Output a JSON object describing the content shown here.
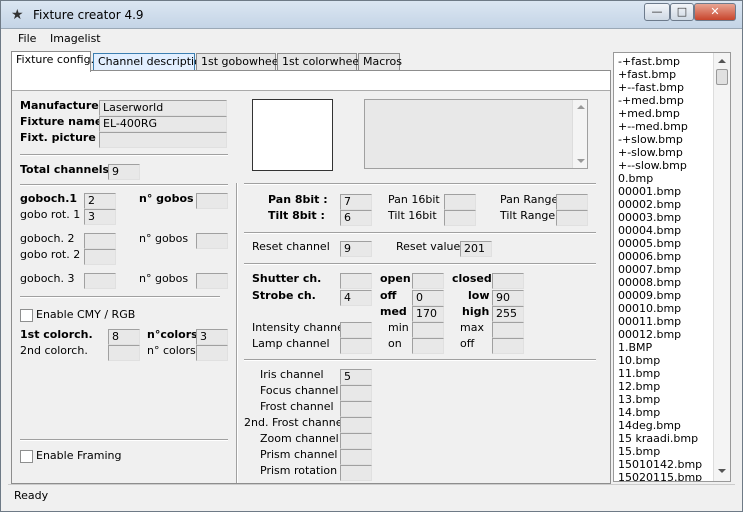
{
  "window": {
    "title": "Fixture creator 4.9"
  },
  "menu": [
    "File",
    "Imagelist"
  ],
  "tabs": [
    "Fixture config.",
    "Channel description",
    "1st gobowheel",
    "1st colorwheel",
    "Macros"
  ],
  "labels": {
    "manufacturer": "Manufacturer",
    "fixture_name": "Fixture name",
    "fixt_picture": "Fixt. picture",
    "total_channels": "Total channels",
    "goboch1": "goboch.1",
    "n_gobos_1": "n° gobos",
    "gobo_rot1": "gobo rot. 1",
    "goboch2": "goboch. 2",
    "n_gobos_2": "n° gobos",
    "gobo_rot2": "gobo rot. 2",
    "goboch3": "goboch. 3",
    "n_gobos_3": "n° gobos",
    "enable_cmy": "Enable CMY / RGB",
    "colorch1": "1st colorch.",
    "n_colors_1": "n°colors",
    "colorch2": "2nd colorch.",
    "n_colors_2": "n° colors",
    "enable_framing": "Enable Framing",
    "pan8": "Pan 8bit :",
    "tilt8": "Tilt 8bit :",
    "pan16": "Pan 16bit",
    "tilt16": "Tilt 16bit",
    "pan_range": "Pan Range",
    "tilt_range": "Tilt Range",
    "reset_channel": "Reset channel",
    "reset_value": "Reset value",
    "shutter": "Shutter ch.",
    "strobe": "Strobe ch.",
    "open": "open",
    "closed": "closed",
    "off": "off",
    "low": "low",
    "med": "med",
    "high": "high",
    "intensity": "Intensity channel",
    "min": "min",
    "max": "max",
    "lamp": "Lamp channel",
    "on": "on",
    "lamp_off": "off",
    "iris": "Iris channel",
    "focus": "Focus channel",
    "frost": "Frost channel",
    "frost2": "2nd. Frost channel",
    "zoom": "Zoom channel",
    "prism": "Prism channel",
    "prism_rot": "Prism rotation"
  },
  "values": {
    "manufacturer": "Laserworld",
    "fixture_name": "EL-400RG",
    "fixt_picture": "",
    "total_channels": "9",
    "goboch1": "2",
    "n_gobos_1": "",
    "gobo_rot1": "3",
    "goboch2": "",
    "n_gobos_2": "",
    "gobo_rot2": "",
    "goboch3": "",
    "n_gobos_3": "",
    "colorch1": "8",
    "n_colors_1": "3",
    "colorch2": "",
    "n_colors_2": "",
    "pan8": "7",
    "tilt8": "6",
    "pan16": "",
    "tilt16": "",
    "pan_range": "",
    "tilt_range": "",
    "reset_channel": "9",
    "reset_value": "201",
    "shutter": "",
    "open": "",
    "closed": "",
    "strobe": "4",
    "off": "0",
    "low": "90",
    "med": "170",
    "high": "255",
    "intensity": "",
    "min": "",
    "max": "",
    "lamp": "",
    "on": "",
    "lamp_off": "",
    "iris": "5",
    "focus": "",
    "frost": "",
    "frost2": "",
    "zoom": "",
    "prism": "",
    "prism_rot": ""
  },
  "imagelist": [
    "-+fast.bmp",
    "+fast.bmp",
    "+--fast.bmp",
    "-+med.bmp",
    "+med.bmp",
    "+--med.bmp",
    "-+slow.bmp",
    "+-slow.bmp",
    "+--slow.bmp",
    "0.bmp",
    "00001.bmp",
    "00002.bmp",
    "00003.bmp",
    "00004.bmp",
    "00005.bmp",
    "00006.bmp",
    "00007.bmp",
    "00008.bmp",
    "00009.bmp",
    "00010.bmp",
    "00011.bmp",
    "00012.bmp",
    "1.BMP",
    "10.bmp",
    "11.bmp",
    "12.bmp",
    "13.bmp",
    "14.bmp",
    "14deg.bmp",
    "15 kraadi.bmp",
    "15.bmp",
    "15010142.bmp",
    "15020115.bmp"
  ],
  "status": "Ready"
}
